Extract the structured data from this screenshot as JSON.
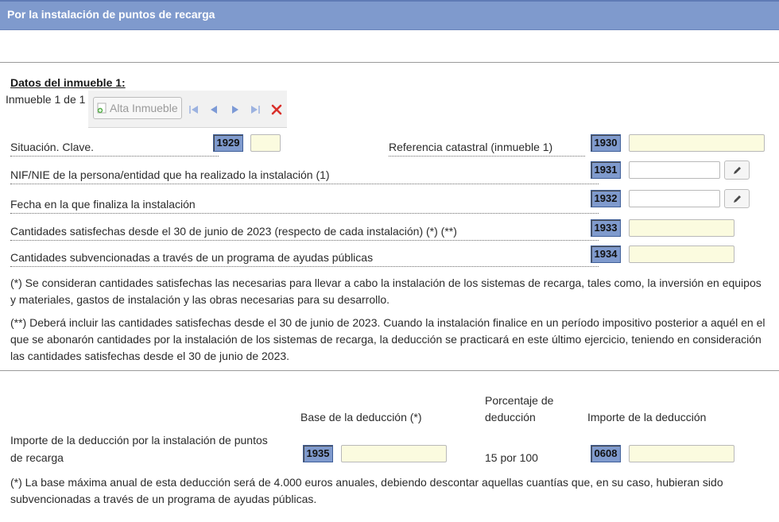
{
  "header": {
    "title": "Por la instalación de puntos de recarga"
  },
  "property": {
    "subtitle": "Datos del inmueble 1:",
    "counter": "Inmueble 1 de 1",
    "add_button": "Alta Inmueble"
  },
  "fields": {
    "situacion": {
      "label": "Situación. Clave.",
      "code": "1929",
      "value": ""
    },
    "referencia": {
      "label": "Referencia catastral (inmueble 1)",
      "code": "1930",
      "value": ""
    },
    "nif": {
      "label": "NIF/NIE de la persona/entidad que ha realizado la instalación (1)",
      "code": "1931",
      "value": ""
    },
    "fecha": {
      "label": "Fecha en la que finaliza la instalación",
      "code": "1932",
      "value": ""
    },
    "cantidades": {
      "label": "Cantidades satisfechas desde el 30 de junio de 2023 (respecto de cada instalación) (*) (**)",
      "code": "1933",
      "value": ""
    },
    "subvencionadas": {
      "label": "Cantidades subvencionadas a través de un programa de ayudas públicas",
      "code": "1934",
      "value": ""
    }
  },
  "notes": {
    "note1": "(*) Se consideran cantidades satisfechas las necesarias para llevar a cabo la instalación de los sistemas de recarga, tales como, la inversión en equipos y materiales, gastos de instalación y las obras necesarias para su desarrollo.",
    "note2": "(**) Deberá incluir las cantidades satisfechas desde el 30 de junio de 2023. Cuando la instalación finalice en un período impositivo posterior a aquél en el que se abonarón cantidades por la instalación de los sistemas de recarga, la deducción se practicará en este último ejercicio, teniendo en consideración las cantidades satisfechas desde el 30 de junio de 2023."
  },
  "deduction": {
    "col_base": "Base de la deducción (*)",
    "col_pct_line1": "Porcentaje de",
    "col_pct_line2": "deducción",
    "col_importe": "Importe de la deducción",
    "row_label_line1": "Importe de la deducción por la instalación de puntos",
    "row_label_line2": "de recarga",
    "base_code": "1935",
    "base_value": "",
    "pct_value": "15 por 100",
    "importe_code": "0608",
    "importe_value": "",
    "footnote": "(*) La base máxima anual de esta deducción será de 4.000 euros anuales, debiendo descontar aquellas cuantías que, en su caso, hubieran sido subvencionadas a través de un programa de ayudas públicas."
  },
  "colors": {
    "header_bg": "#7f9acd",
    "code_bg": "#7f9acd",
    "field_yellow": "#fbfbdf",
    "delete_red": "#d9302b",
    "nav_blue": "#7d9ad6"
  },
  "icons": [
    "add-icon",
    "first-icon",
    "prev-icon",
    "next-icon",
    "last-icon",
    "delete-icon",
    "pencil-icon"
  ]
}
